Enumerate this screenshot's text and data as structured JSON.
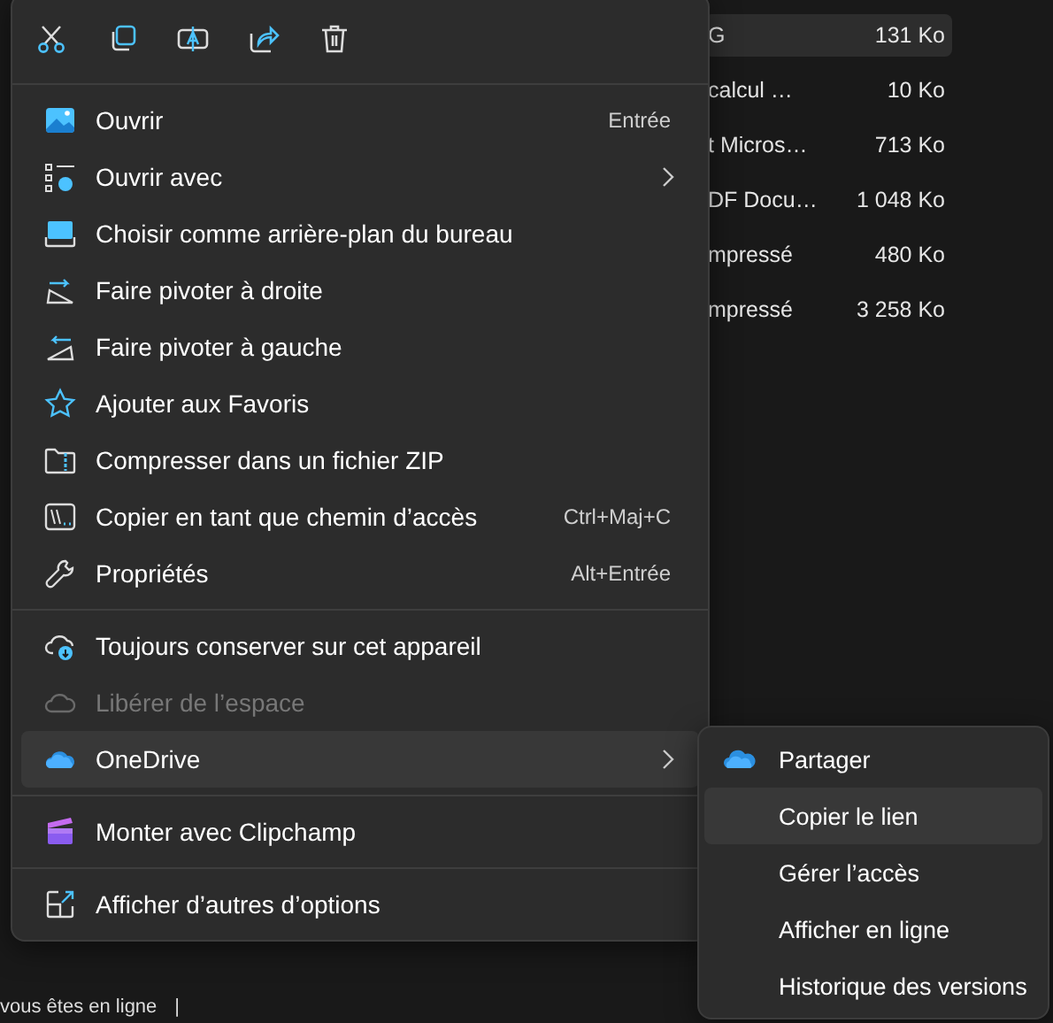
{
  "file_list": [
    {
      "name": "G",
      "size": "131 Ko",
      "selected": true
    },
    {
      "name": "calcul …",
      "size": "10 Ko",
      "selected": false
    },
    {
      "name": "t Micros…",
      "size": "713 Ko",
      "selected": false
    },
    {
      "name": "DF Docu…",
      "size": "1 048 Ko",
      "selected": false
    },
    {
      "name": "mpressé",
      "size": "480 Ko",
      "selected": false
    },
    {
      "name": "mpressé",
      "size": "3 258 Ko",
      "selected": false
    }
  ],
  "status_bar": {
    "text": "vous êtes en ligne",
    "separator": "|"
  },
  "context_menu": {
    "toolbar": [
      {
        "kind": "cut"
      },
      {
        "kind": "copy"
      },
      {
        "kind": "rename"
      },
      {
        "kind": "share"
      },
      {
        "kind": "delete"
      }
    ],
    "sections": [
      [
        {
          "label": "Ouvrir",
          "shortcut": "Entrée",
          "submenu": false,
          "disabled": false,
          "selected": false
        },
        {
          "label": "Ouvrir avec",
          "submenu": true,
          "disabled": false,
          "selected": false
        },
        {
          "label": "Choisir comme arrière-plan du bureau",
          "submenu": false,
          "disabled": false,
          "selected": false
        },
        {
          "label": "Faire pivoter à droite",
          "submenu": false,
          "disabled": false,
          "selected": false
        },
        {
          "label": "Faire pivoter à gauche",
          "submenu": false,
          "disabled": false,
          "selected": false
        },
        {
          "label": "Ajouter aux Favoris",
          "submenu": false,
          "disabled": false,
          "selected": false
        },
        {
          "label": "Compresser dans un fichier ZIP",
          "submenu": false,
          "disabled": false,
          "selected": false
        },
        {
          "label": "Copier en tant que chemin d’accès",
          "shortcut": "Ctrl+Maj+C",
          "submenu": false,
          "disabled": false,
          "selected": false
        },
        {
          "label": "Propriétés",
          "shortcut": "Alt+Entrée",
          "submenu": false,
          "disabled": false,
          "selected": false
        }
      ],
      [
        {
          "label": "Toujours conserver sur cet appareil",
          "submenu": false,
          "disabled": false,
          "selected": false
        },
        {
          "label": "Libérer de l’espace",
          "submenu": false,
          "disabled": true,
          "selected": false
        },
        {
          "label": "OneDrive",
          "submenu": true,
          "disabled": false,
          "selected": true
        }
      ],
      [
        {
          "label": "Monter avec Clipchamp",
          "submenu": false,
          "disabled": false,
          "selected": false
        }
      ],
      [
        {
          "label": "Afficher d’autres d’options",
          "submenu": false,
          "disabled": false,
          "selected": false
        }
      ]
    ]
  },
  "submenu": {
    "items": [
      {
        "label": "Partager",
        "selected": false
      },
      {
        "label": "Copier le lien",
        "selected": true
      },
      {
        "label": "Gérer l’accès",
        "selected": false
      },
      {
        "label": "Afficher en ligne",
        "selected": false
      },
      {
        "label": "Historique des versions",
        "selected": false
      }
    ]
  }
}
